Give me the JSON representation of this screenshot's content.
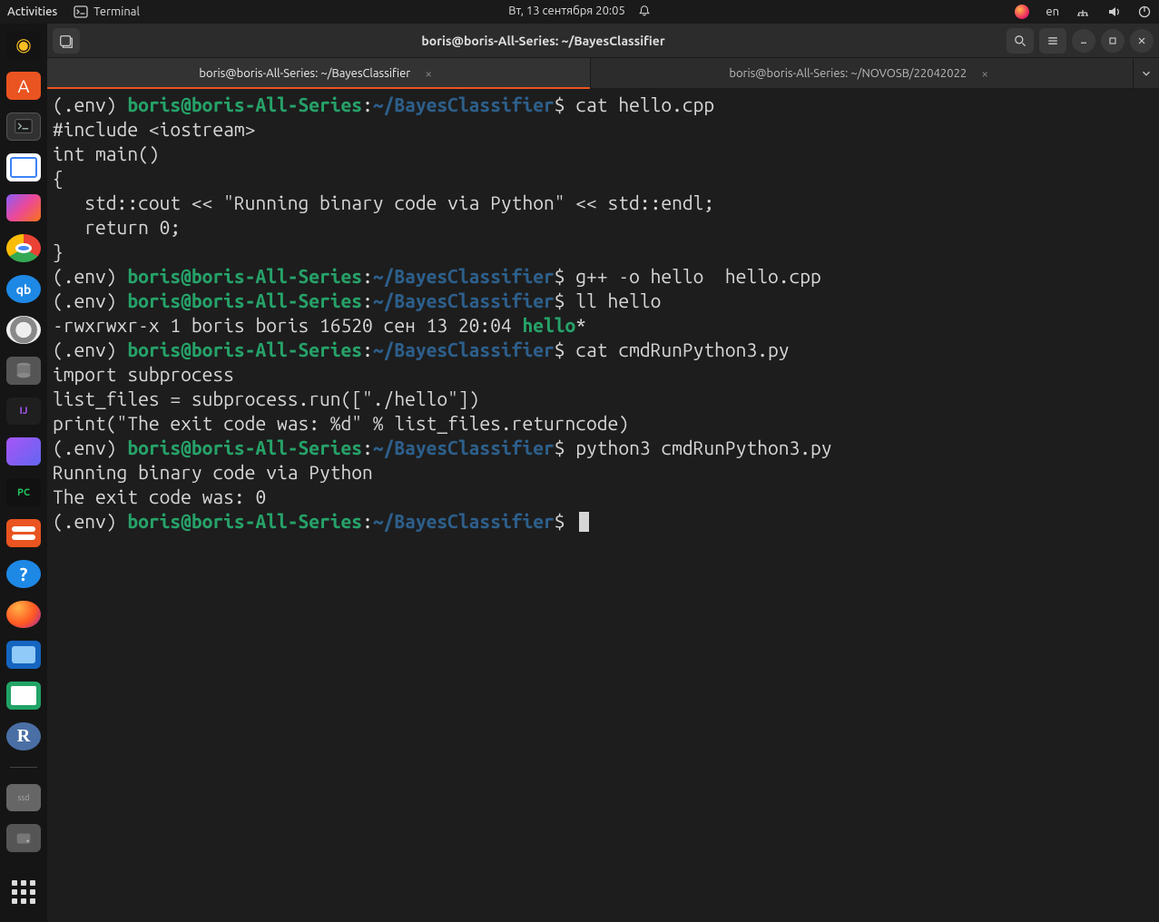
{
  "panel": {
    "activities": "Activities",
    "app_name": "Terminal",
    "clock": "Вт, 13 сентября  20:05",
    "lang": "en"
  },
  "dock": {
    "items": [
      "rhythmbox",
      "software",
      "terminal",
      "gedit",
      "analyzer",
      "chrome",
      "qbit",
      "disc",
      "db",
      "idea",
      "vector",
      "pycharm",
      "settings",
      "help",
      "firefox",
      "shotwell",
      "calc",
      "r"
    ]
  },
  "window": {
    "title": "boris@boris-All-Series: ~/BayesClassifier",
    "tabs": [
      {
        "label": "boris@boris-All-Series: ~/BayesClassifier",
        "active": true
      },
      {
        "label": "boris@boris-All-Series: ~/NOVOSB/22042022",
        "active": false
      }
    ]
  },
  "prompt": {
    "venv": "(.env) ",
    "user": "boris@boris-All-Series",
    "sep": ":",
    "path": "~/BayesClassifier",
    "dollar": "$ "
  },
  "session": {
    "cmd1": "cat hello.cpp",
    "out1_l1": "#include <iostream>",
    "out1_l2": "int main()",
    "out1_l3": "{",
    "out1_l4": "   std::cout << \"Running binary code via Python\" << std::endl;",
    "out1_l5": "   return 0;",
    "out1_l6": "}",
    "cmd2": "g++ -o hello  hello.cpp",
    "cmd3": "ll hello",
    "out3_pre": "-rwxrwxr-x 1 boris boris 16520 сен 13 20:04 ",
    "out3_file": "hello",
    "out3_post": "*",
    "cmd4": "cat cmdRunPython3.py",
    "out4_l1": "import subprocess",
    "out4_l2": "list_files = subprocess.run([\"./hello\"])",
    "out4_l3": "print(\"The exit code was: %d\" % list_files.returncode)",
    "cmd5": "python3 cmdRunPython3.py",
    "out5_l1": "Running binary code via Python",
    "out5_l2": "The exit code was: 0"
  }
}
